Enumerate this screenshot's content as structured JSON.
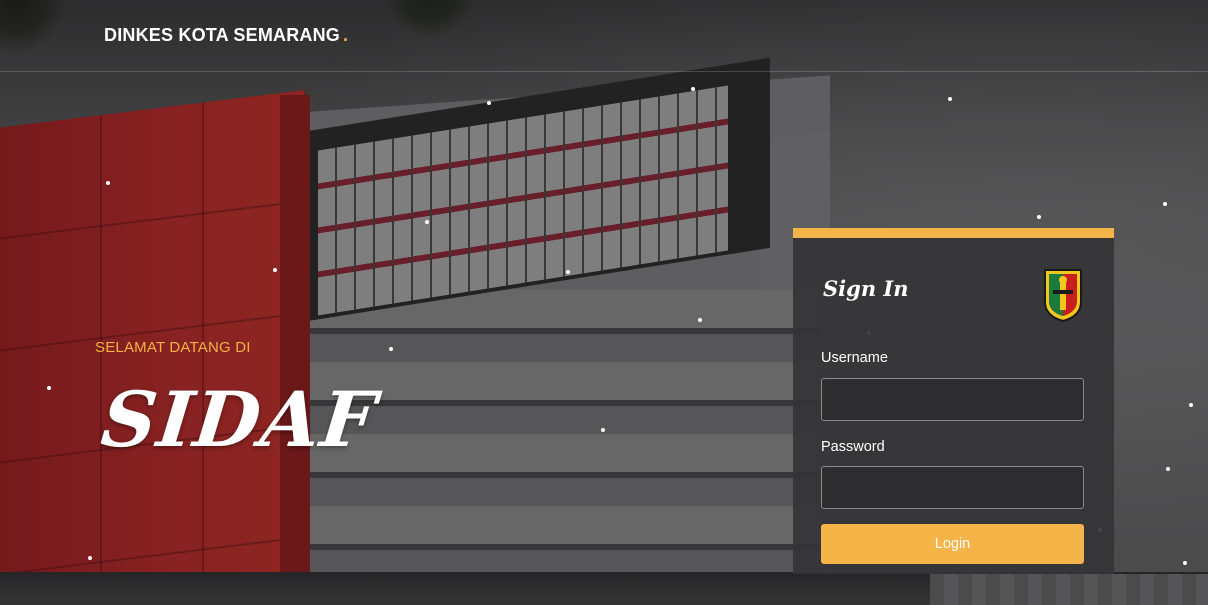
{
  "header": {
    "brand": "DINKES KOTA SEMARANG",
    "brand_dot": "."
  },
  "hero": {
    "welcome": "SELAMAT DATANG DI",
    "title": "SIDAF"
  },
  "login_card": {
    "title": "Sign In",
    "username_label": "Username",
    "username_value": "",
    "password_label": "Password",
    "password_value": "",
    "button_label": "Login",
    "emblem_icon": "semarang-city-emblem-icon"
  },
  "colors": {
    "accent": "#f5b448",
    "card_bg": "#343436",
    "text": "#ffffff"
  }
}
